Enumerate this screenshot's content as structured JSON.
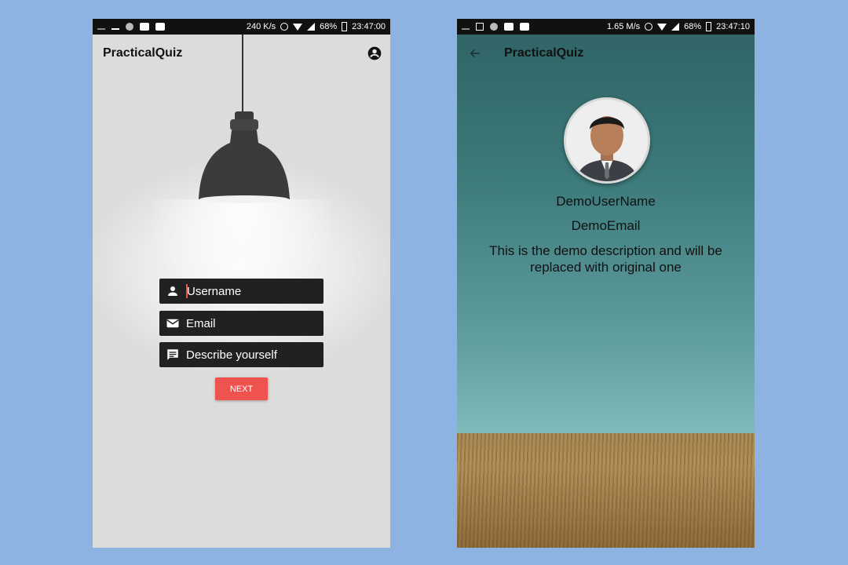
{
  "left": {
    "status": {
      "left_icons": [
        "usb-icon",
        "download-icon",
        "circle-icon",
        "youtube-icon",
        "youtube-icon"
      ],
      "speed": "240 K/s",
      "battery": "68%",
      "time": "23:47:00"
    },
    "app_title": "PracticalQuiz",
    "fields": [
      {
        "placeholder": "Username",
        "icon": "person-icon"
      },
      {
        "placeholder": "Email",
        "icon": "mail-icon"
      },
      {
        "placeholder": "Describe yourself",
        "icon": "comment-icon"
      }
    ],
    "next_label": "NEXT"
  },
  "right": {
    "status": {
      "left_icons": [
        "usb-icon",
        "image-icon",
        "circle-icon",
        "youtube-icon",
        "youtube-icon"
      ],
      "speed": "1.65 M/s",
      "battery": "68%",
      "time": "23:47:10"
    },
    "app_title": "PracticalQuiz",
    "username": "DemoUserName",
    "email": "DemoEmail",
    "description": "This is the demo description and will be replaced with original one"
  },
  "colors": {
    "accent": "#ef5350",
    "field_bg": "#212121",
    "background": "#8db3e2"
  }
}
